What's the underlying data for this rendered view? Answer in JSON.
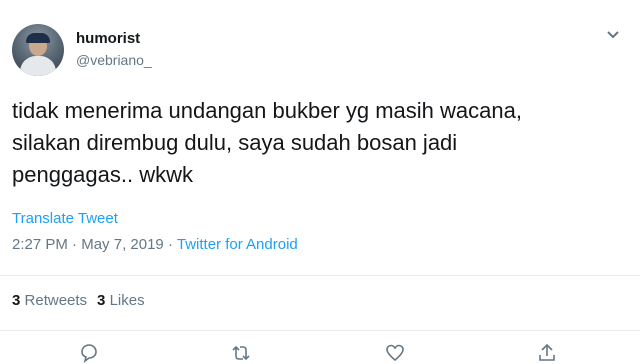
{
  "tweet": {
    "author": {
      "display_name": "humorist",
      "handle": "@vebriano_",
      "avatar_icon": "profile-photo"
    },
    "text_lines": [
      "tidak menerima undangan bukber yg masih wacana,",
      "silakan dirembug dulu, saya sudah bosan jadi",
      "penggagas.. wkwk"
    ],
    "translate_label": "Translate Tweet",
    "time": "2:27 PM",
    "date": "May 7, 2019",
    "separator": "·",
    "source": "Twitter for Android",
    "stats": {
      "retweets_count": "3",
      "retweets_label": "Retweets",
      "likes_count": "3",
      "likes_label": "Likes"
    },
    "actions": [
      "reply-icon",
      "retweet-icon",
      "like-icon",
      "share-icon"
    ]
  },
  "colors": {
    "accent": "#1da1f2",
    "text": "#14171a",
    "muted": "#657786",
    "divider": "#e6ecf0"
  }
}
